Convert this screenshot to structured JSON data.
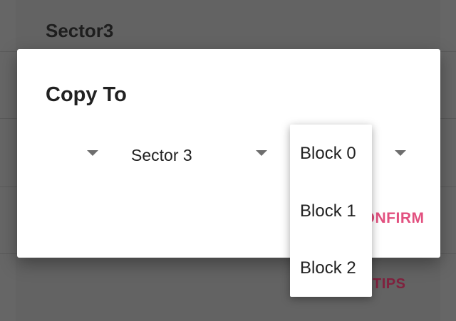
{
  "background": {
    "section_title": "Sector3",
    "tips_label": "TIPS"
  },
  "dialog": {
    "title": "Copy To",
    "spinners": [
      {
        "value": ""
      },
      {
        "value": "Sector 3"
      },
      {
        "value": "Block 0"
      }
    ],
    "confirm_label": "CONFIRM"
  },
  "dropdown": {
    "options": [
      "Block 0",
      "Block 1",
      "Block 2"
    ]
  },
  "colors": {
    "accent": "#e2507f",
    "scrim": "#666666"
  }
}
